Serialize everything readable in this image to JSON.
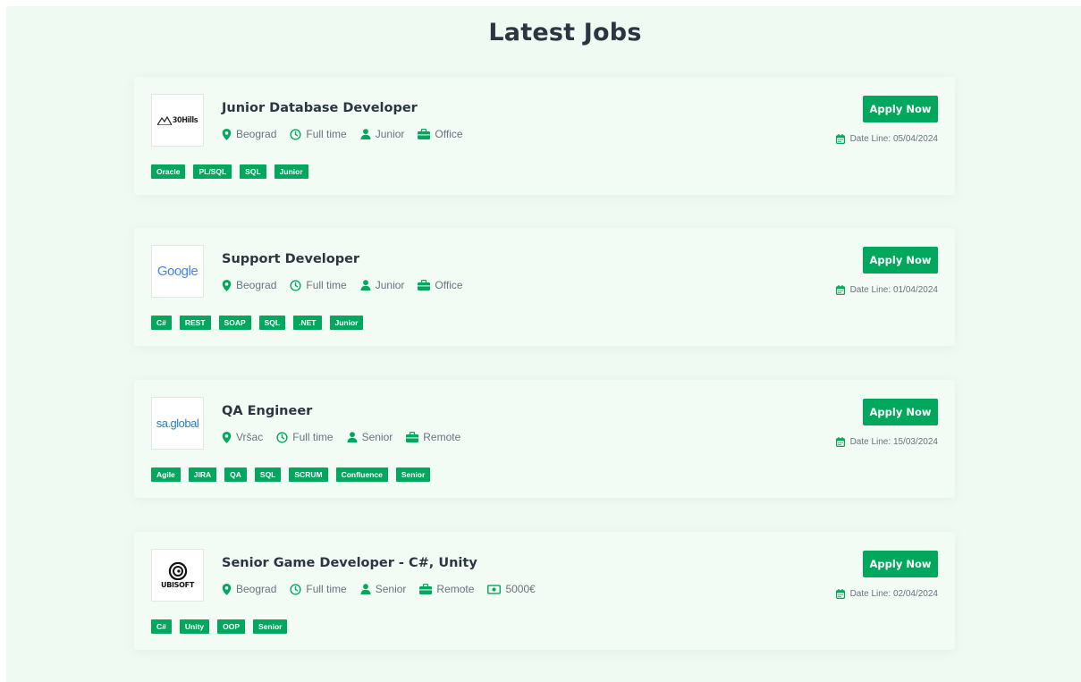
{
  "heading": "Latest Jobs",
  "apply_label": "Apply Now",
  "date_prefix": "Date Line:",
  "accent_color": "#00a75d",
  "jobs": [
    {
      "logo_text": "30Hills",
      "title": "Junior Database Developer",
      "location": "Beograd",
      "type": "Full time",
      "level": "Junior",
      "workplace": "Office",
      "salary": "",
      "date": "05/04/2024",
      "tags": [
        "Oracle",
        "PL/SQL",
        "SQL",
        "Junior"
      ]
    },
    {
      "logo_text": "Google",
      "title": "Support Developer",
      "location": "Beograd",
      "type": "Full time",
      "level": "Junior",
      "workplace": "Office",
      "salary": "",
      "date": "01/04/2024",
      "tags": [
        "C#",
        "REST",
        "SOAP",
        "SQL",
        ".NET",
        "Junior"
      ]
    },
    {
      "logo_text": "sa.global",
      "title": "QA Engineer",
      "location": "Vršac",
      "type": "Full time",
      "level": "Senior",
      "workplace": "Remote",
      "salary": "",
      "date": "15/03/2024",
      "tags": [
        "Agile",
        "JIRA",
        "QA",
        "SQL",
        "SCRUM",
        "Confluence",
        "Senior"
      ]
    },
    {
      "logo_text": "UBISOFT",
      "title": "Senior Game Developer - C#, Unity",
      "location": "Beograd",
      "type": "Full time",
      "level": "Senior",
      "workplace": "Remote",
      "salary": "5000€",
      "date": "02/04/2024",
      "tags": [
        "C#",
        "Unity",
        "OOP",
        "Senior"
      ]
    }
  ]
}
